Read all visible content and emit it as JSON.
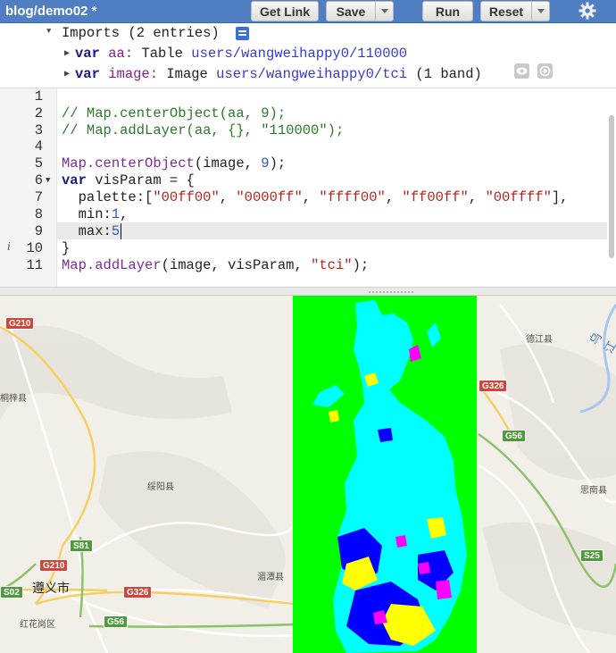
{
  "toolbar": {
    "title": "blog/demo02 *",
    "get_link": "Get Link",
    "save": "Save",
    "run": "Run",
    "reset": "Reset"
  },
  "imports": {
    "header": "Imports (2 entries)",
    "entries": [
      {
        "keyword": "var",
        "name": "aa:",
        "type": "Table",
        "path": "users/wangweihappy0/110000",
        "extra": ""
      },
      {
        "keyword": "var",
        "name": "image:",
        "type": "Image",
        "path": "users/wangweihappy0/tci",
        "extra": "(1 band)"
      }
    ]
  },
  "editor": {
    "line_numbers": [
      "1",
      "2",
      "3",
      "4",
      "5",
      "6",
      "7",
      "8",
      "9",
      "10",
      "11"
    ],
    "lines": {
      "l2": "// Map.centerObject(aa, 9);",
      "l3": "// Map.addLayer(aa, {}, \"110000\");",
      "l5a": "Map.",
      "l5b": "centerObject",
      "l5c": "(image, ",
      "l5d": "9",
      "l5e": ");",
      "l6a": "var",
      "l6b": " visParam = {",
      "l7a": "  palette:[",
      "l7b": "\"00ff00\"",
      "l7c": ", ",
      "l7d": "\"0000ff\"",
      "l7e": ", ",
      "l7f": "\"ffff00\"",
      "l7g": ", ",
      "l7h": "\"ff00ff\"",
      "l7i": ", ",
      "l7j": "\"00ffff\"",
      "l7k": "],",
      "l8a": "  min:",
      "l8b": "1",
      "l8c": ",",
      "l9a": "  max:",
      "l9b": "5",
      "l10": "}",
      "l11a": "Map.",
      "l11b": "addLayer",
      "l11c": "(image, visParam, ",
      "l11d": "\"tci\"",
      "l11e": ");"
    }
  },
  "map": {
    "shields": [
      {
        "label": "G210",
        "kind": "red"
      },
      {
        "label": "G326",
        "kind": "red"
      },
      {
        "label": "G56",
        "kind": "green"
      },
      {
        "label": "S81",
        "kind": "green"
      },
      {
        "label": "G210",
        "kind": "red"
      },
      {
        "label": "G326",
        "kind": "red"
      },
      {
        "label": "S02",
        "kind": "green"
      },
      {
        "label": "G56",
        "kind": "green"
      },
      {
        "label": "S25",
        "kind": "green"
      }
    ],
    "places": [
      "桐梓县",
      "绥阳县",
      "湄潭县",
      "红花岗区",
      "德江县",
      "思南县"
    ],
    "city": "遵义市",
    "river": "乌江"
  },
  "colors": {
    "toolbar": "#4f7ec2",
    "green": "#00ff00",
    "blue": "#0000ff",
    "yellow": "#ffff00",
    "magenta": "#ff00ff",
    "cyan": "#00ffff"
  }
}
